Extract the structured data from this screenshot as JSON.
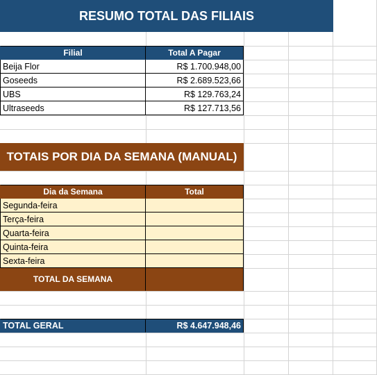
{
  "summary": {
    "title": "RESUMO TOTAL DAS FILIAIS",
    "headers": {
      "filial": "Filial",
      "total": "Total A Pagar"
    },
    "rows": [
      {
        "filial": "Beija Flor",
        "total": "R$ 1.700.948,00"
      },
      {
        "filial": "Goseeds",
        "total": "R$ 2.689.523,66"
      },
      {
        "filial": "UBS",
        "total": "R$ 129.763,24"
      },
      {
        "filial": "Ultraseeds",
        "total": "R$ 127.713,56"
      }
    ]
  },
  "weekday": {
    "title": "TOTAIS POR DIA DA SEMANA (MANUAL)",
    "headers": {
      "day": "Dia da Semana",
      "total": "Total"
    },
    "rows": [
      {
        "day": "Segunda-feira",
        "total": ""
      },
      {
        "day": "Terça-feira",
        "total": ""
      },
      {
        "day": "Quarta-feira",
        "total": ""
      },
      {
        "day": "Quinta-feira",
        "total": ""
      },
      {
        "day": "Sexta-feira",
        "total": ""
      }
    ],
    "week_total_label": "TOTAL DA SEMANA",
    "week_total_value": ""
  },
  "grand_total": {
    "label": "TOTAL GERAL",
    "value": "R$ 4.647.948,46"
  },
  "colors": {
    "blue": "#1f4e79",
    "brown": "#8b4513",
    "beige": "#fff2cc",
    "grid": "#d4d4d4"
  }
}
